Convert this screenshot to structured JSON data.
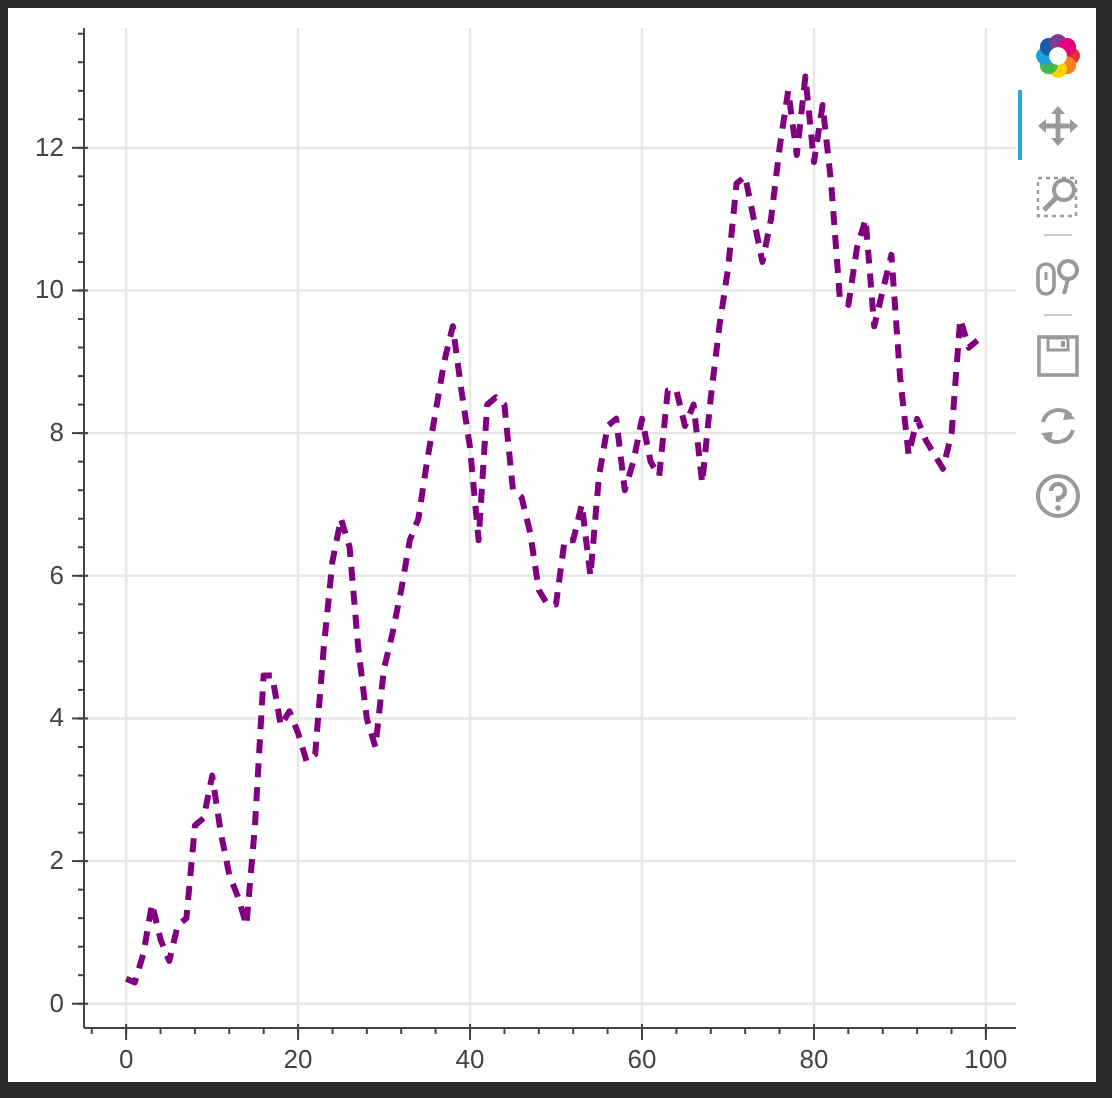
{
  "plot": {
    "chart_data": {
      "type": "line",
      "x": [
        0,
        1,
        2,
        3,
        4,
        5,
        6,
        7,
        8,
        9,
        10,
        11,
        12,
        13,
        14,
        15,
        16,
        17,
        18,
        19,
        20,
        21,
        22,
        23,
        24,
        25,
        26,
        27,
        28,
        29,
        30,
        31,
        32,
        33,
        34,
        35,
        36,
        37,
        38,
        39,
        40,
        41,
        42,
        43,
        44,
        45,
        46,
        47,
        48,
        49,
        50,
        51,
        52,
        53,
        54,
        55,
        56,
        57,
        58,
        59,
        60,
        61,
        62,
        63,
        64,
        65,
        66,
        67,
        68,
        69,
        70,
        71,
        72,
        73,
        74,
        75,
        76,
        77,
        78,
        79,
        80,
        81,
        82,
        83,
        84,
        85,
        86,
        87,
        88,
        89,
        90,
        91,
        92,
        93,
        94,
        95,
        96,
        97,
        98,
        99
      ],
      "series": [
        {
          "color": "#800080",
          "line_style": "dashed",
          "values": [
            0.35,
            0.3,
            0.7,
            1.4,
            0.9,
            0.6,
            1.1,
            1.2,
            2.5,
            2.6,
            3.2,
            2.4,
            1.8,
            1.5,
            1.1,
            2.5,
            4.6,
            4.6,
            3.9,
            4.1,
            3.8,
            3.4,
            3.5,
            5.0,
            6.2,
            6.8,
            6.4,
            5.0,
            4.0,
            3.6,
            4.7,
            5.2,
            5.8,
            6.5,
            6.8,
            7.6,
            8.3,
            9.0,
            9.5,
            8.6,
            7.8,
            6.5,
            8.4,
            8.5,
            8.4,
            7.2,
            7.1,
            6.6,
            5.8,
            5.6,
            5.6,
            6.5,
            6.5,
            7.0,
            6.0,
            7.4,
            8.1,
            8.2,
            7.2,
            7.6,
            8.2,
            7.6,
            7.4,
            8.6,
            8.6,
            8.1,
            8.4,
            7.3,
            8.5,
            9.5,
            10.3,
            11.5,
            11.6,
            11.0,
            10.4,
            11.0,
            12.0,
            12.8,
            11.9,
            13.0,
            11.8,
            12.6,
            11.5,
            9.9,
            9.8,
            10.6,
            11.0,
            9.5,
            10.0,
            10.5,
            8.8,
            7.7,
            8.2,
            7.9,
            7.7,
            7.5,
            8.0,
            9.6,
            9.2,
            9.3
          ]
        }
      ],
      "grid": true,
      "xlim": [
        -4.9,
        103.5
      ],
      "ylim": [
        -0.34,
        13.68
      ],
      "xticks": [
        0,
        20,
        40,
        60,
        80,
        100
      ],
      "yticks": [
        0,
        2,
        4,
        6,
        8,
        10,
        12
      ]
    }
  },
  "toolbar": {
    "tools": [
      {
        "kind": "logo"
      },
      {
        "kind": "pan",
        "active": true
      },
      {
        "kind": "box_zoom",
        "active": false
      },
      {
        "kind": "wheel_zoom",
        "active": false,
        "separator_before": true
      },
      {
        "kind": "save",
        "separator_before": true
      },
      {
        "kind": "reset"
      },
      {
        "kind": "help"
      }
    ]
  }
}
